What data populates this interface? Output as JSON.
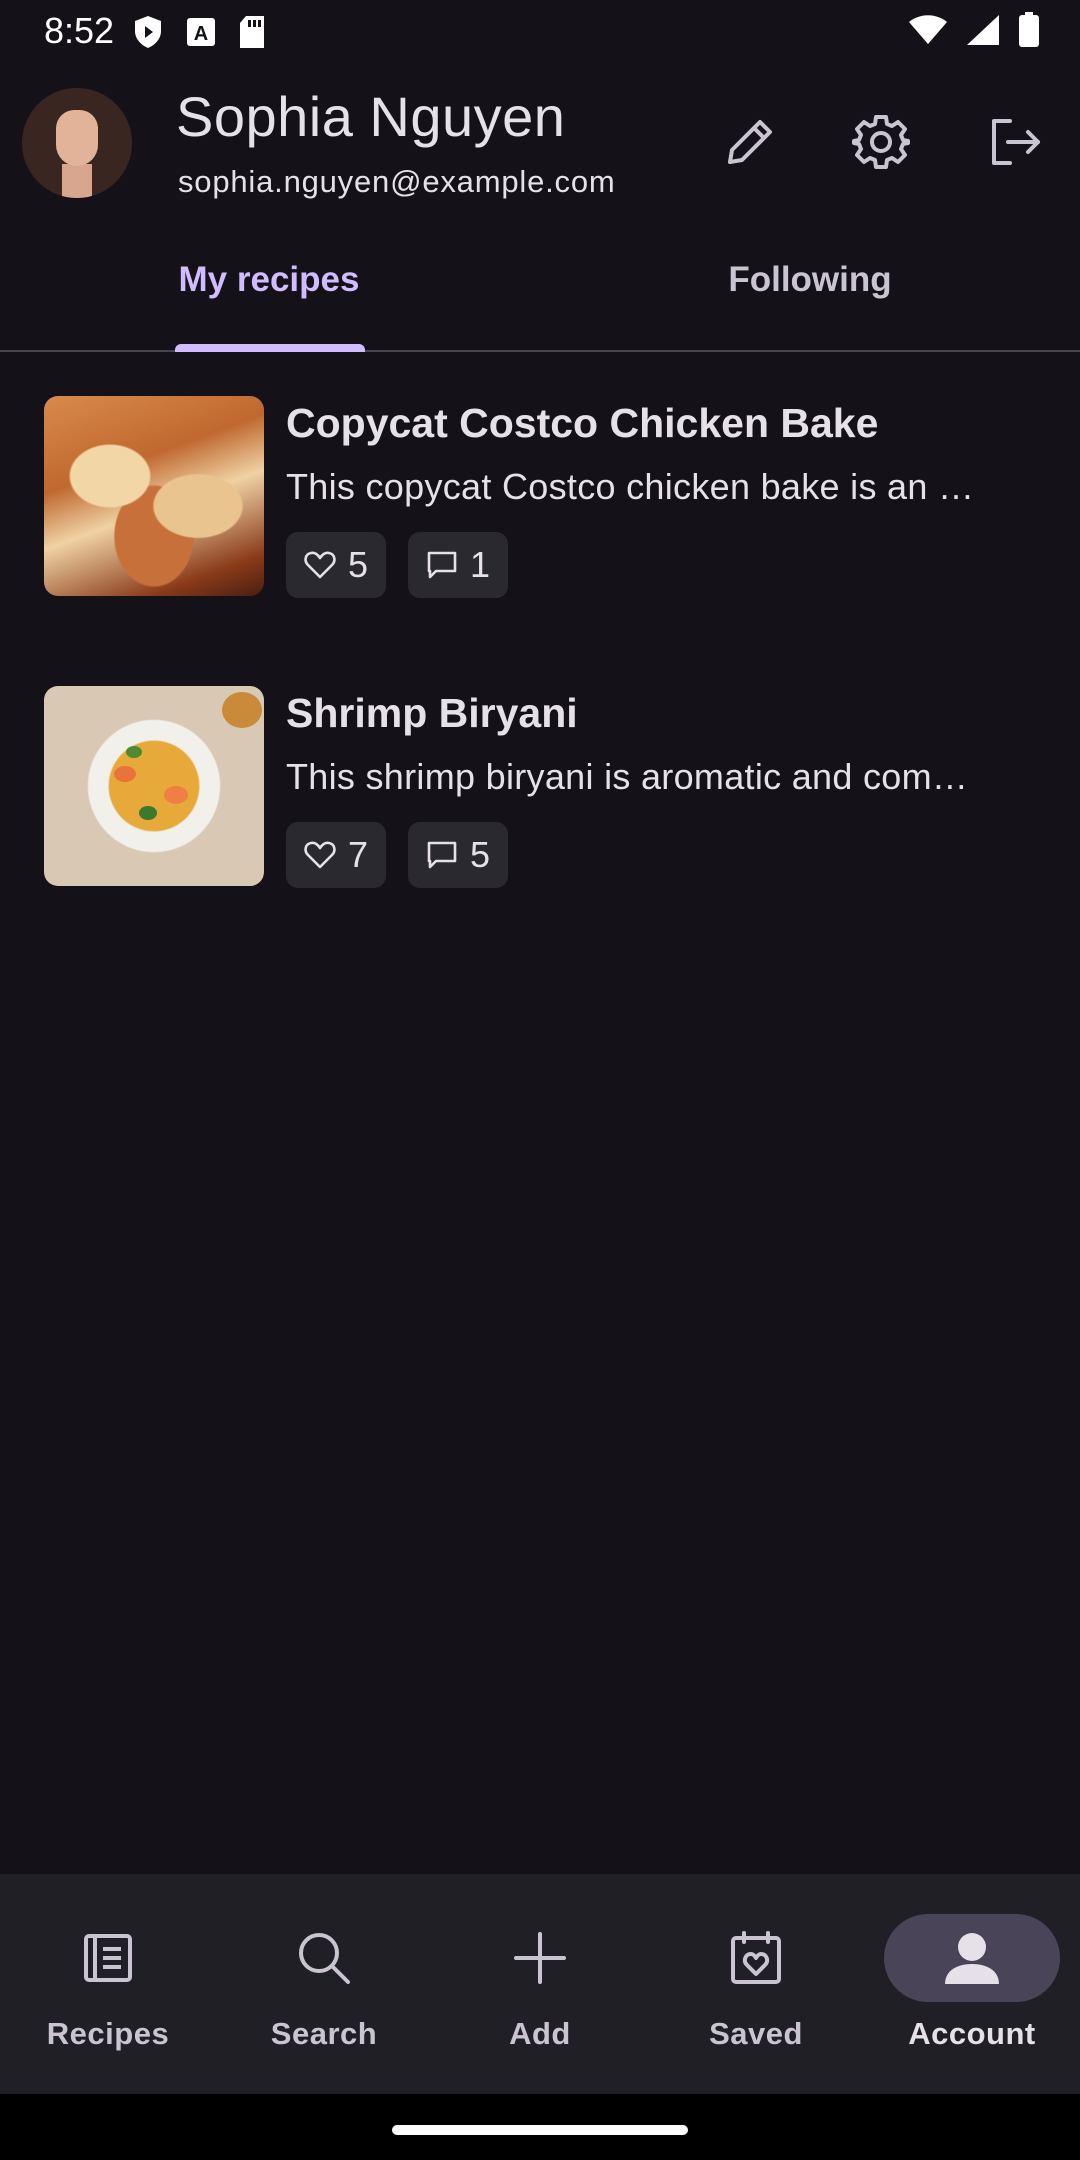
{
  "status_bar": {
    "time": "8:52"
  },
  "profile": {
    "name": "Sophia Nguyen",
    "email": "sophia.nguyen@example.com"
  },
  "tabs": [
    {
      "label": "My recipes",
      "selected": true
    },
    {
      "label": "Following",
      "selected": false
    }
  ],
  "recipes": [
    {
      "title": "Copycat Costco Chicken Bake",
      "description": "This copycat Costco chicken bake is an …",
      "likes": "5",
      "comments": "1"
    },
    {
      "title": "Shrimp Biryani",
      "description": "This shrimp biryani is aromatic and com…",
      "likes": "7",
      "comments": "5"
    }
  ],
  "bottom_nav": [
    {
      "label": "Recipes",
      "icon": "recipes-icon",
      "active": false
    },
    {
      "label": "Search",
      "icon": "search-icon",
      "active": false
    },
    {
      "label": "Add",
      "icon": "add-icon",
      "active": false
    },
    {
      "label": "Saved",
      "icon": "saved-icon",
      "active": false
    },
    {
      "label": "Account",
      "icon": "account-icon",
      "active": true
    }
  ],
  "colors": {
    "background": "#141218",
    "accent": "#d0bcff",
    "nav_background": "#211f26",
    "active_indicator": "#4a4458"
  }
}
